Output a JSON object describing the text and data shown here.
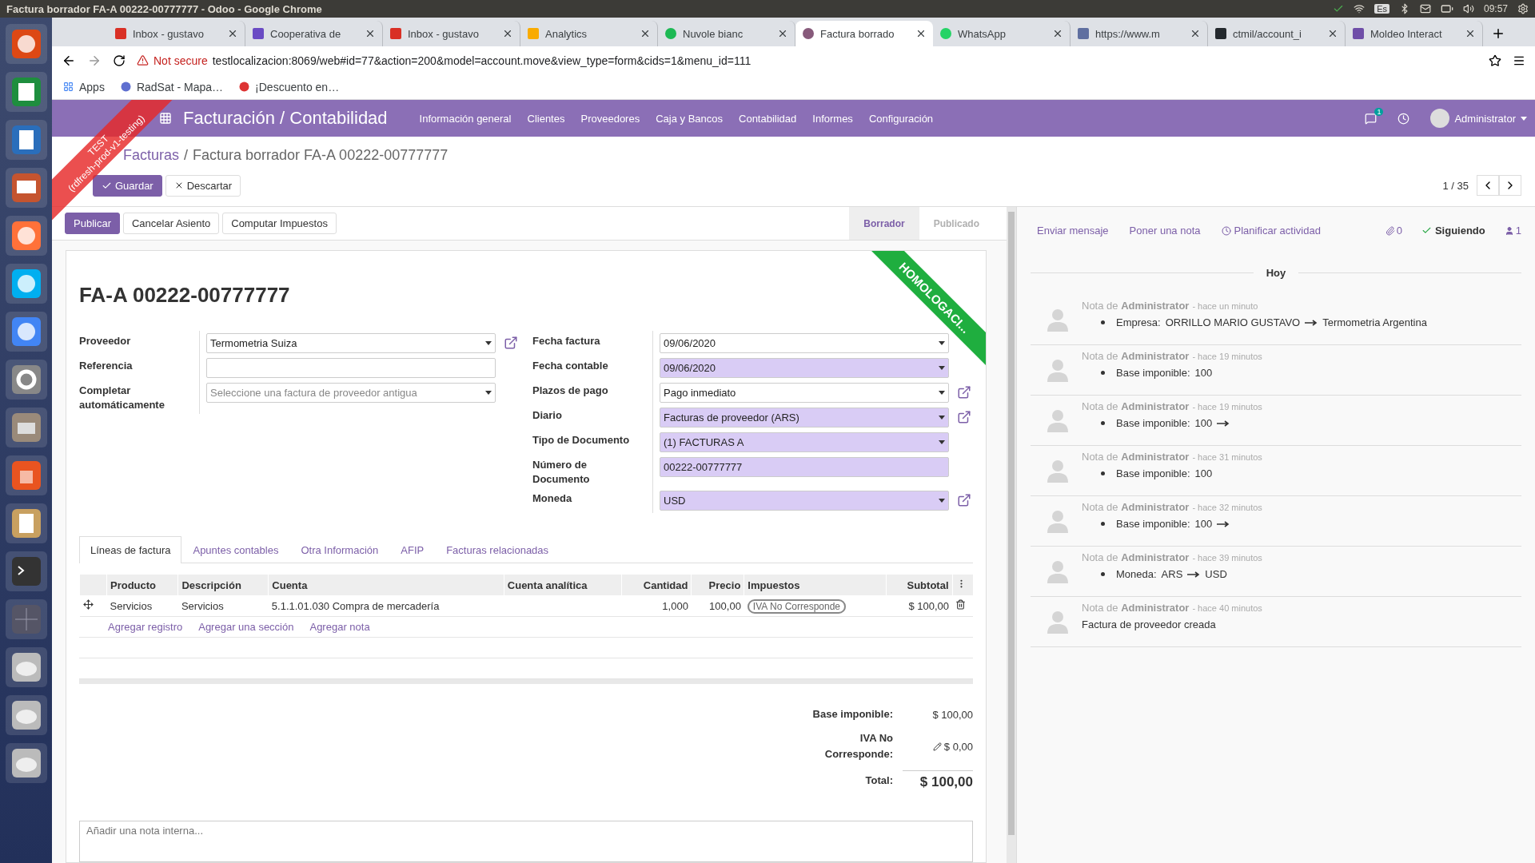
{
  "os_bar": {
    "title": "Factura borrador FA-A 00222-00777777 - Odoo - Google Chrome",
    "keyboard": "Es",
    "time": "09:57"
  },
  "browser": {
    "tabs": [
      {
        "title": "Inbox - gustavo",
        "selected": false
      },
      {
        "title": "Cooperativa de",
        "selected": false
      },
      {
        "title": "Inbox - gustavo",
        "selected": false
      },
      {
        "title": "Analytics",
        "selected": false
      },
      {
        "title": "Nuvole bianc",
        "selected": false
      },
      {
        "title": "Factura borrado",
        "selected": true
      },
      {
        "title": "WhatsApp",
        "selected": false
      },
      {
        "title": "https://www.m",
        "selected": false
      },
      {
        "title": "ctmil/account_i",
        "selected": false
      },
      {
        "title": "Moldeo Interact",
        "selected": false
      }
    ],
    "url_warning": "Not secure",
    "url": "testlocalizacion:8069/web#id=77&action=200&model=account.move&view_type=form&cids=1&menu_id=111",
    "bookmarks": [
      "Apps",
      "RadSat - Mapa…",
      "¡Descuento en…"
    ]
  },
  "ribbon": {
    "text": "TEST",
    "subtext": "(rdfresh-prod-v1-testing)"
  },
  "navbar": {
    "app": "Facturación / Contabilidad",
    "menu": [
      "Información general",
      "Clientes",
      "Proveedores",
      "Caja y Bancos",
      "Contabilidad",
      "Informes",
      "Configuración"
    ],
    "chat_badge": "1",
    "user": "Administrator"
  },
  "control_panel": {
    "breadcrumb": "Facturas",
    "separator": "/",
    "current": "Factura borrador FA-A 00222-00777777",
    "buttons": [
      {
        "label": "Guardar",
        "kind": "primary"
      },
      {
        "label": "Descartar",
        "kind": "discard"
      }
    ],
    "pager": "1 / 35"
  },
  "header": {
    "buttons": [
      {
        "label": "Publicar",
        "primary": true
      },
      {
        "label": "Cancelar Asiento",
        "primary": false
      },
      {
        "label": "Computar Impuestos",
        "primary": false
      }
    ],
    "stages": [
      {
        "label": "Borrador",
        "selected": true
      },
      {
        "label": "Publicado",
        "selected": false
      }
    ]
  },
  "sheet": {
    "ribbon": "HOMOLOGACI...",
    "title": "FA-A 00222-00777777",
    "left_fields": [
      {
        "label": "Proveedor",
        "kind": "select",
        "value": "Termometria Suiza",
        "required": false,
        "link": true
      },
      {
        "label": "Referencia",
        "kind": "input",
        "required": false,
        "link": false
      },
      {
        "label": "Completar automáticamente",
        "kind": "select",
        "placeholder": "Seleccione una factura de proveedor antigua",
        "required": false,
        "link": false
      }
    ],
    "right_fields": [
      {
        "label": "Fecha factura",
        "kind": "select",
        "value": "09/06/2020",
        "required": false,
        "link": false
      },
      {
        "label": "Fecha contable",
        "kind": "select",
        "value": "09/06/2020",
        "required": true,
        "link": false
      },
      {
        "label": "Plazos de pago",
        "kind": "select",
        "value": "Pago inmediato",
        "required": false,
        "link": true
      },
      {
        "label": "Diario",
        "kind": "select",
        "value": "Facturas de proveedor (ARS)",
        "required": true,
        "link": true
      },
      {
        "label": "Tipo de Documento",
        "kind": "select",
        "value": "(1) FACTURAS A",
        "required": true,
        "link": false
      },
      {
        "label": "Número de Documento",
        "kind": "input",
        "value": "00222-00777777",
        "required": true,
        "link": false
      },
      {
        "label": "Moneda",
        "kind": "select",
        "value": "USD",
        "required": true,
        "link": true
      }
    ],
    "tabs": [
      {
        "label": "Líneas de factura",
        "selected": true
      },
      {
        "label": "Apuntes contables",
        "selected": false
      },
      {
        "label": "Otra Información",
        "selected": false
      },
      {
        "label": "AFIP",
        "selected": false
      },
      {
        "label": "Facturas relacionadas",
        "selected": false
      }
    ],
    "table": {
      "columns": [
        "Producto",
        "Descripción",
        "Cuenta",
        "Cuenta analítica",
        "Cantidad",
        "Precio",
        "Impuestos",
        "Subtotal"
      ],
      "rows": [
        {
          "product": "Servicios",
          "description": "Servicios",
          "account": "5.1.1.01.030 Compra de mercadería",
          "quantity": "1,000",
          "price": "100,00",
          "tax": "IVA No Corresponde",
          "subtotal": "$ 100,00"
        }
      ]
    },
    "add_links": [
      "Agregar registro",
      "Agregar una sección",
      "Agregar nota"
    ],
    "totals": [
      {
        "label": "Base imponible:",
        "value": "$ 100,00",
        "kind": "plain"
      },
      {
        "label": "IVA No Corresponde:",
        "value": "$ 0,00",
        "kind": "editable"
      },
      {
        "label": "Total:",
        "value": "$ 100,00",
        "kind": "grand"
      }
    ],
    "note_placeholder": "Añadir una nota interna..."
  },
  "chatter": {
    "actions": [
      "Enviar mensaje",
      "Poner una nota"
    ],
    "activity": "Planificar actividad",
    "attachments": "0",
    "follow": "Siguiendo",
    "followers": "1",
    "day": "Hoy",
    "messages": [
      {
        "header": "Nota de **Administrator**",
        "time": "- hace un minuto",
        "changes": [
          {
            "field": "Empresa:",
            "old": "ORRILLO MARIO GUSTAVO",
            "arrow": true,
            "new": "Termometria Argentina"
          }
        ]
      },
      {
        "header": "Nota de **Administrator**",
        "time": "- hace 19 minutos",
        "changes": [
          {
            "field": "Base imponible:",
            "old": "100",
            "arrow": false
          }
        ]
      },
      {
        "header": "Nota de **Administrator**",
        "time": "- hace 19 minutos",
        "changes": [
          {
            "field": "Base imponible:",
            "old": "100",
            "arrow": true
          }
        ]
      },
      {
        "header": "Nota de **Administrator**",
        "time": "- hace 31 minutos",
        "changes": [
          {
            "field": "Base imponible:",
            "old": "100",
            "arrow": false
          }
        ]
      },
      {
        "header": "Nota de **Administrator**",
        "time": "- hace 32 minutos",
        "changes": [
          {
            "field": "Base imponible:",
            "old": "100",
            "arrow": true
          }
        ]
      },
      {
        "header": "Nota de **Administrator**",
        "time": "- hace 39 minutos",
        "changes": [
          {
            "field": "Moneda:",
            "old": "ARS",
            "arrow": true,
            "new": "USD"
          }
        ]
      },
      {
        "header": "Nota de **Administrator**",
        "time": "- hace 40 minutos",
        "body": "Factura de proveedor creada"
      }
    ]
  }
}
